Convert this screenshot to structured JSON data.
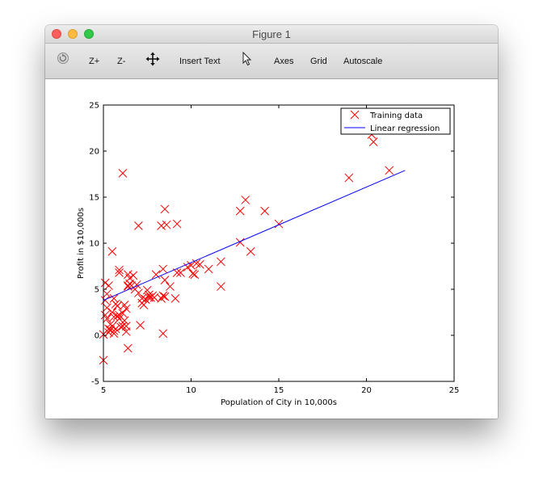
{
  "window": {
    "title": "Figure 1"
  },
  "toolbar": {
    "items": [
      {
        "id": "rotate",
        "label": "",
        "icon": "rotate-icon"
      },
      {
        "id": "zoom_in",
        "label": "Z+"
      },
      {
        "id": "zoom_out",
        "label": "Z-"
      },
      {
        "id": "pan",
        "label": "",
        "icon": "pan-move-icon"
      },
      {
        "id": "insert_text",
        "label": "Insert Text"
      },
      {
        "id": "select",
        "label": "",
        "icon": "cursor-arrow-icon"
      },
      {
        "id": "axes",
        "label": "Axes"
      },
      {
        "id": "grid",
        "label": "Grid"
      },
      {
        "id": "autoscale",
        "label": "Autoscale"
      }
    ]
  },
  "chart_data": {
    "type": "scatter",
    "title": "",
    "xlabel": "Population of City in 10,000s",
    "ylabel": "Profit in $10,000s",
    "xlim": [
      5,
      25
    ],
    "ylim": [
      -5,
      25
    ],
    "xticks": [
      "5",
      "10",
      "15",
      "20",
      "25"
    ],
    "yticks": [
      "-5",
      "0",
      "5",
      "10",
      "15",
      "20",
      "25"
    ],
    "grid": false,
    "legend_position": "top-right",
    "colors": {
      "training": "#ff0000",
      "regression": "#0000ff"
    },
    "series": [
      {
        "name": "Training data",
        "type": "scatter",
        "marker": "x",
        "x": [
          5.1,
          5.5,
          5.9,
          6.1,
          8.5,
          7.0,
          8.3,
          9.2,
          8.6,
          5.6,
          5.9,
          7.6,
          6.1,
          6.4,
          5.8,
          6.3,
          6.4,
          7.8,
          8.4,
          9.8,
          5.3,
          10.1,
          12.8,
          13.1,
          14.2,
          15.0,
          19.0,
          20.3,
          20.4,
          21.3,
          12.8,
          13.4,
          11.7,
          11.7,
          10.2,
          10.5,
          9.2,
          9.1,
          8.8,
          8.5,
          8.4,
          8.4,
          8.5,
          7.9,
          7.6,
          7.5,
          7.4,
          7.3,
          7.2,
          7.1,
          7.0,
          6.8,
          6.6,
          6.5,
          6.4,
          6.3,
          6.2,
          6.1,
          6.0,
          5.9,
          5.8,
          5.7,
          5.6,
          5.5,
          5.4,
          5.3,
          5.2,
          5.1,
          5.0,
          5.0,
          5.1,
          5.2,
          5.3,
          5.4,
          5.5,
          5.6,
          5.7,
          5.8,
          6.2,
          6.3,
          6.7,
          6.9,
          7.2,
          7.4,
          5.2,
          5.9,
          10.3,
          8.3,
          9.4,
          10.0,
          11.0,
          8.0,
          6.5,
          5.6,
          7.7,
          6.4
        ],
        "y": [
          5.7,
          9.1,
          7.1,
          17.6,
          13.7,
          11.9,
          11.9,
          12.1,
          12.0,
          4.0,
          6.8,
          4.1,
          2.4,
          5.3,
          3.2,
          1.0,
          -1.4,
          4.3,
          7.2,
          7.4,
          5.4,
          6.7,
          10.1,
          14.7,
          13.5,
          12.1,
          17.1,
          21.8,
          21.0,
          17.9,
          13.5,
          9.1,
          8.0,
          5.3,
          6.6,
          7.7,
          6.8,
          4.0,
          5.3,
          4.2,
          0.2,
          4.3,
          6.0,
          4.1,
          4.4,
          4.9,
          3.9,
          3.3,
          3.5,
          1.1,
          4.6,
          5.0,
          5.4,
          5.6,
          6.6,
          2.9,
          3.3,
          1.0,
          0.9,
          1.8,
          3.2,
          0.7,
          0.5,
          2.5,
          1.2,
          0.7,
          1.8,
          3.8,
          0.1,
          -2.7,
          2.2,
          3.0,
          0.3,
          0.6,
          1.0,
          2.0,
          3.4,
          2.1,
          1.6,
          0.4,
          6.5,
          5.5,
          4.0,
          3.9,
          4.5,
          2.2,
          7.8,
          4.0,
          6.8,
          7.6,
          7.2,
          6.6,
          6.2,
          0.2,
          4.1,
          5.4
        ]
      },
      {
        "name": "Linear regression",
        "type": "line",
        "x": [
          5.0,
          22.2
        ],
        "y": [
          3.8,
          17.9
        ]
      }
    ]
  }
}
